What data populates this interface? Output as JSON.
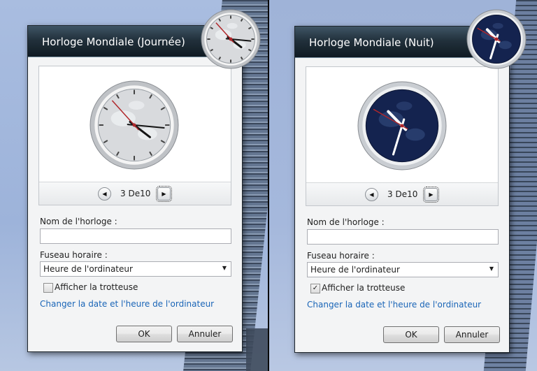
{
  "left": {
    "title": "Horloge Mondiale (Journée)",
    "nav": {
      "prev": "◀",
      "next": "▶",
      "text": "3 De10"
    },
    "name_label": "Nom de l'horloge :",
    "name_value": "",
    "tz_label": "Fuseau horaire :",
    "tz_value": "Heure de l'ordinateur",
    "checkbox_label": "Afficher la trotteuse",
    "checkbox_checked": false,
    "checkbox_mark": "",
    "link": "Changer la date et l'heure de l'ordinateur",
    "ok": "OK",
    "cancel": "Annuler",
    "clock": {
      "hour": 4,
      "minute": 15,
      "second": 53,
      "face": "day",
      "dial_color": "#d8dadd",
      "hand_color": "#151515",
      "second_color": "#b0272b"
    }
  },
  "right": {
    "title": "Horloge Mondiale (Nuit)",
    "nav": {
      "prev": "◀",
      "next": "▶",
      "text": "3 De10"
    },
    "name_label": "Nom de l'horloge :",
    "name_value": "",
    "tz_label": "Fuseau horaire :",
    "tz_value": "Heure de l'ordinateur",
    "checkbox_label": "Afficher la trotteuse",
    "checkbox_checked": true,
    "checkbox_mark": "✓",
    "link": "Changer la date et l'heure de l'ordinateur",
    "ok": "OK",
    "cancel": "Annuler",
    "clock": {
      "hour": 10,
      "minute": 32,
      "second": 50,
      "face": "night",
      "dial_color": "#14234f",
      "hand_color": "#ffffff",
      "second_color": "#b0272b"
    }
  },
  "accent_link_color": "#1a65b7"
}
